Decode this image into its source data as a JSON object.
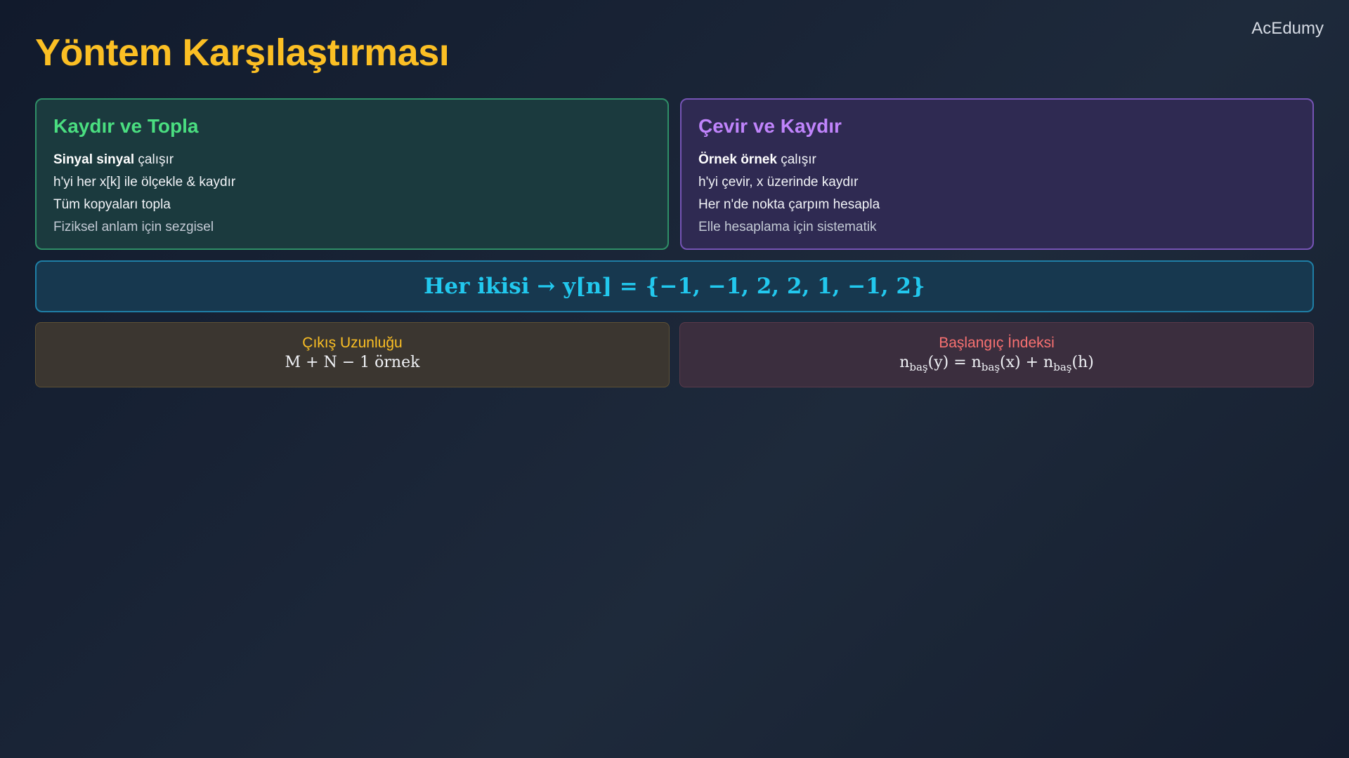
{
  "brand": "AcEdumy",
  "title": "Yöntem Karşılaştırması",
  "left_card": {
    "heading": "Kaydır ve Topla",
    "line1_bold": "Sinyal sinyal",
    "line1_rest": " çalışır",
    "line2": "h'yi her x[k] ile ölçekle & kaydır",
    "line3": "Tüm kopyaları topla",
    "line4": "Fiziksel anlam için sezgisel"
  },
  "right_card": {
    "heading": "Çevir ve Kaydır",
    "line1_bold": "Örnek örnek",
    "line1_rest": " çalışır",
    "line2": "h'yi çevir, x üzerinde kaydır",
    "line3": "Her n'de nokta çarpım hesapla",
    "line4": "Elle hesaplama için sistematik"
  },
  "result_banner": "Her ikisi → y[n] = {−1, −1, 2, 2, 1, −1, 2}",
  "output_length": {
    "title": "Çıkış Uzunluğu",
    "formula": "M + N − 1 örnek"
  },
  "start_index": {
    "title": "Başlangıç İndeksi",
    "n": "n",
    "sub": "baş",
    "arg_y": "(y) = ",
    "arg_x": "(x) + ",
    "arg_h": "(h)"
  },
  "colors": {
    "title": "#fbbf24",
    "left_accent": "#4ade80",
    "right_accent": "#c084fc",
    "banner_text": "#22c8ee",
    "start_index_title": "#f87171"
  }
}
